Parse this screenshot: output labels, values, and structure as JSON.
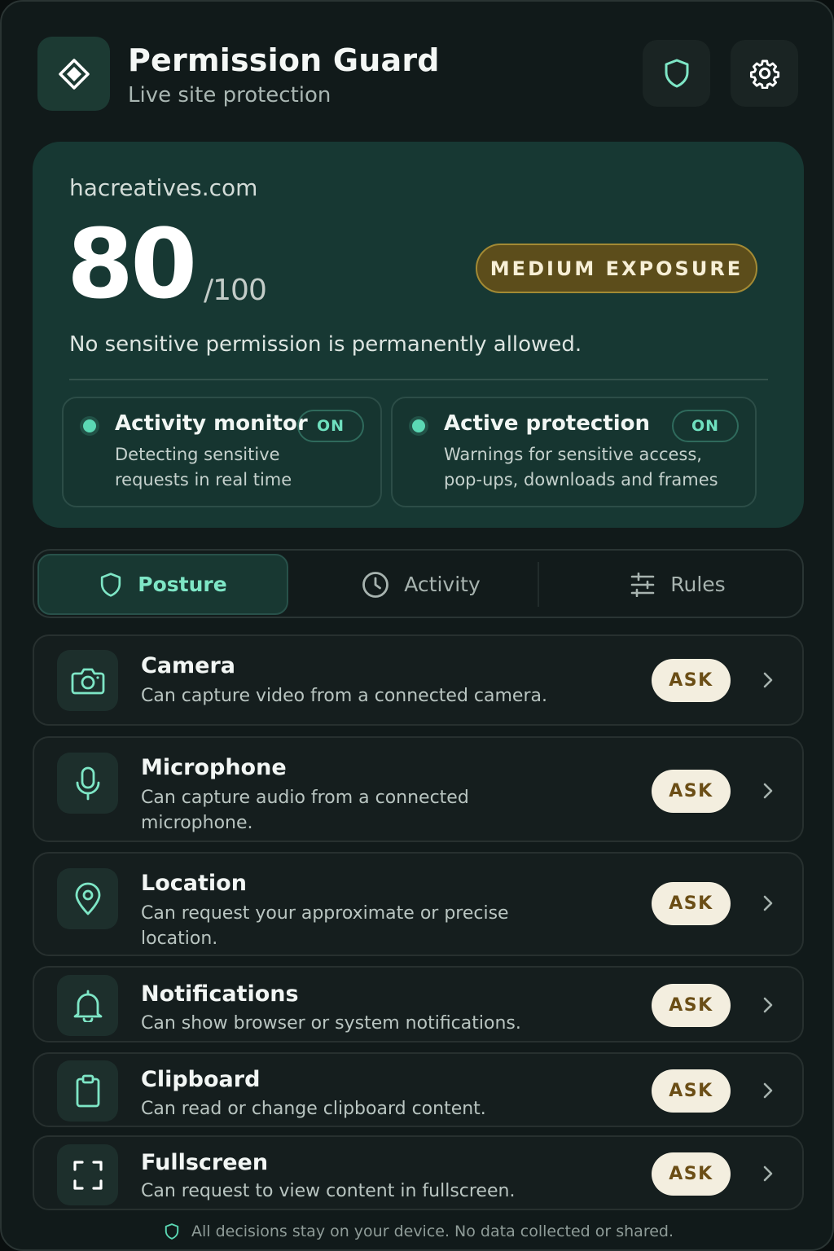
{
  "header": {
    "title": "Permission Guard",
    "subtitle": "Live site protection",
    "logo_icon": "diamond-icon",
    "buttons": [
      {
        "icon": "shield-icon"
      },
      {
        "icon": "gear-icon"
      }
    ]
  },
  "site": {
    "domain": "hacreatives.com",
    "score": "80",
    "score_max": "/100",
    "exposure_label": "MEDIUM EXPOSURE",
    "note": "No sensitive permission is permanently allowed."
  },
  "status": [
    {
      "title": "Activity monitor",
      "state": "ON",
      "desc_line1": "Detecting sensitive",
      "desc_line2": "requests in real time"
    },
    {
      "title": "Active protection",
      "state": "ON",
      "desc_line1": "Warnings for sensitive access,",
      "desc_line2": "pop-ups, downloads and frames"
    }
  ],
  "tabs": [
    {
      "label": "Posture",
      "icon": "shield-icon",
      "active": true
    },
    {
      "label": "Activity",
      "icon": "clock-icon",
      "active": false
    },
    {
      "label": "Rules",
      "icon": "sliders-icon",
      "active": false
    }
  ],
  "permissions": [
    {
      "title": "Camera",
      "desc": "Can capture video from a connected camera.",
      "action": "ASK",
      "icon": "camera-icon"
    },
    {
      "title": "Microphone",
      "desc": "Can capture audio from a connected microphone.",
      "action": "ASK",
      "icon": "microphone-icon"
    },
    {
      "title": "Location",
      "desc": "Can request your approximate or precise location.",
      "action": "ASK",
      "icon": "location-pin-icon"
    },
    {
      "title": "Notifications",
      "desc": "Can show browser or system notifications.",
      "action": "ASK",
      "icon": "bell-icon"
    },
    {
      "title": "Clipboard",
      "desc": "Can read or change clipboard content.",
      "action": "ASK",
      "icon": "clipboard-icon"
    },
    {
      "title": "Fullscreen",
      "desc": "Can request to view content in fullscreen.",
      "action": "ASK",
      "icon": "fullscreen-icon"
    }
  ],
  "footer": {
    "text": "All decisions stay on your device. No data collected or shared.",
    "icon": "shield-icon"
  },
  "colors": {
    "accent": "#5bd8b4",
    "background": "#111a1a",
    "hero": "#173833",
    "exposure_badge": "#5c4d1b",
    "ask_pill": "#f3eedf"
  }
}
